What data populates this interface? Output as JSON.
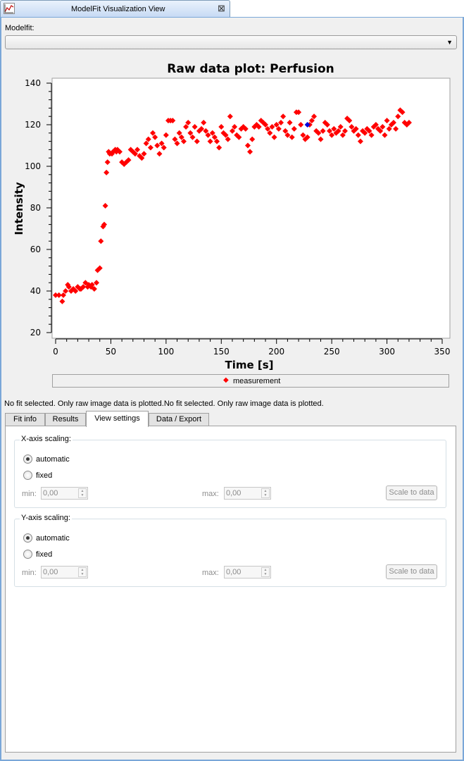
{
  "window": {
    "title": "ModelFit Visualization View",
    "icon": "chart-view-icon",
    "close_icon": "close-icon",
    "close_glyph": "⊠"
  },
  "modelfit": {
    "label": "Modelfit:",
    "selected": "",
    "arrow": "▼"
  },
  "chart_data": {
    "type": "scatter",
    "title": "Raw data plot: Perfusion",
    "xlabel": "Time [s]",
    "ylabel": "Intensity",
    "xlim": [
      0,
      350
    ],
    "ylim": [
      20,
      140
    ],
    "xticks": [
      0,
      50,
      100,
      150,
      200,
      250,
      300,
      350
    ],
    "yticks": [
      20,
      40,
      60,
      80,
      100,
      120,
      140
    ],
    "grid": false,
    "legend_position": "bottom",
    "colors": {
      "measurement": "#ff0000",
      "selected": "#0000dd"
    },
    "series": [
      {
        "name": "measurement",
        "x": [
          0,
          3,
          6,
          7,
          9,
          11,
          12,
          14,
          16,
          18,
          20,
          22,
          23,
          25,
          27,
          29,
          30,
          32,
          33,
          35,
          37,
          38,
          40,
          41,
          43,
          44,
          45,
          46,
          47,
          48,
          49,
          51,
          52,
          54,
          55,
          56,
          58,
          60,
          62,
          64,
          66,
          68,
          70,
          72,
          74,
          76,
          78,
          80,
          82,
          84,
          86,
          88,
          90,
          92,
          94,
          96,
          98,
          100,
          102,
          104,
          106,
          108,
          110,
          112,
          114,
          116,
          118,
          120,
          122,
          124,
          126,
          128,
          130,
          132,
          134,
          136,
          138,
          140,
          142,
          144,
          146,
          148,
          150,
          152,
          154,
          156,
          158,
          160,
          162,
          164,
          166,
          168,
          170,
          172,
          174,
          176,
          178,
          180,
          182,
          184,
          186,
          188,
          190,
          192,
          194,
          196,
          198,
          200,
          202,
          204,
          206,
          208,
          210,
          212,
          214,
          216,
          218,
          220,
          222,
          224,
          226,
          228,
          230,
          232,
          234,
          236,
          238,
          240,
          242,
          244,
          246,
          248,
          250,
          252,
          254,
          256,
          258,
          260,
          262,
          264,
          266,
          268,
          270,
          272,
          274,
          276,
          278,
          280,
          282,
          284,
          286,
          288,
          290,
          292,
          294,
          296,
          298,
          300,
          302,
          304,
          306,
          308,
          310,
          312,
          314,
          316,
          318,
          320
        ],
        "y": [
          38,
          38,
          35,
          38,
          40,
          43,
          42,
          40,
          41,
          40,
          42,
          41,
          41,
          42,
          44,
          42,
          43,
          42,
          43,
          41,
          44,
          50,
          51,
          64,
          71,
          72,
          81,
          97,
          102,
          107,
          106,
          106,
          107,
          108,
          107,
          108,
          107,
          102,
          101,
          102,
          103,
          108,
          107,
          106,
          108,
          105,
          104,
          106,
          111,
          113,
          109,
          116,
          114,
          110,
          106,
          111,
          109,
          115,
          122,
          122,
          122,
          113,
          111,
          116,
          114,
          112,
          119,
          121,
          116,
          114,
          119,
          112,
          117,
          118,
          121,
          117,
          115,
          112,
          116,
          114,
          112,
          109,
          119,
          116,
          115,
          113,
          124,
          117,
          119,
          115,
          114,
          118,
          119,
          118,
          110,
          107,
          113,
          119,
          120,
          119,
          122,
          121,
          120,
          118,
          116,
          119,
          114,
          120,
          118,
          121,
          124,
          117,
          115,
          121,
          114,
          118,
          126,
          126,
          120,
          115,
          113,
          114,
          120,
          122,
          124,
          117,
          116,
          113,
          117,
          121,
          120,
          117,
          115,
          118,
          116,
          117,
          119,
          115,
          117,
          123,
          122,
          119,
          117,
          118,
          115,
          112,
          117,
          116,
          118,
          117,
          115,
          119,
          120,
          118,
          117,
          119,
          115,
          122,
          118,
          120,
          121,
          118,
          124,
          127,
          126,
          121,
          120,
          121
        ]
      }
    ],
    "selected_point": {
      "x": 228,
      "y": 120
    }
  },
  "legend": {
    "marker": "◆",
    "label": "measurement"
  },
  "status_message": "No fit selected. Only raw image data is plotted.No fit selected. Only raw image data is plotted.",
  "tabs": [
    {
      "label": "Fit info",
      "active": false
    },
    {
      "label": "Results",
      "active": false
    },
    {
      "label": "View settings",
      "active": true
    },
    {
      "label": "Data / Export",
      "active": false
    }
  ],
  "view_settings": {
    "x_axis": {
      "title": "X-axis scaling:",
      "automatic_label": "automatic",
      "fixed_label": "fixed",
      "mode": "automatic",
      "min_label": "min:",
      "min_value": "0,00",
      "max_label": "max:",
      "max_value": "0,00",
      "scale_button": "Scale to data"
    },
    "y_axis": {
      "title": "Y-axis scaling:",
      "automatic_label": "automatic",
      "fixed_label": "fixed",
      "mode": "automatic",
      "min_label": "min:",
      "min_value": "0,00",
      "max_label": "max:",
      "max_value": "0,00",
      "scale_button": "Scale to data"
    }
  },
  "spin_arrows": {
    "up": "▲",
    "down": "▼"
  }
}
